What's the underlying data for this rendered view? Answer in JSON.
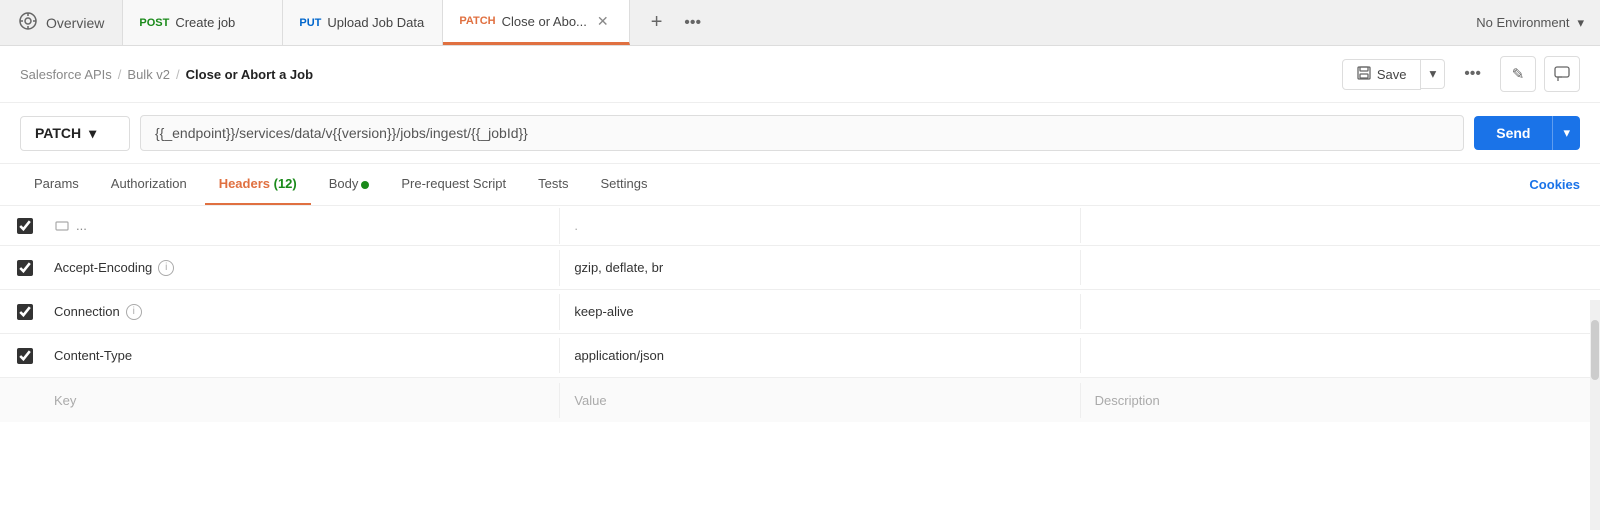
{
  "tabs": {
    "overview": {
      "label": "Overview",
      "icon": "○"
    },
    "items": [
      {
        "id": "create-job",
        "method": "POST",
        "method_class": "method-post",
        "label": "Create job",
        "active": false
      },
      {
        "id": "upload-job-data",
        "method": "PUT",
        "method_class": "method-put",
        "label": "Upload Job Data",
        "active": false
      },
      {
        "id": "close-abort-job",
        "method": "PATCH",
        "method_class": "method-patch",
        "label": "Close or Abo...",
        "active": true,
        "closable": true
      }
    ],
    "add_label": "+",
    "more_label": "•••"
  },
  "env": {
    "label": "No Environment",
    "chevron": "❯"
  },
  "breadcrumb": {
    "parts": [
      "Salesforce APIs",
      "Bulk v2"
    ],
    "current": "Close or Abort a Job"
  },
  "toolbar": {
    "save_label": "Save",
    "more_label": "•••",
    "edit_icon": "✎",
    "comment_icon": "▤"
  },
  "url_bar": {
    "method": "PATCH",
    "url_prefix": "{{_endpoint}}",
    "url_middle": "/services/data/v",
    "url_version": "{{version}}",
    "url_suffix1": "/jobs/ingest/",
    "url_suffix2": "{{_jobId}}",
    "send_label": "Send"
  },
  "request_tabs": {
    "items": [
      {
        "id": "params",
        "label": "Params",
        "active": false
      },
      {
        "id": "authorization",
        "label": "Authorization",
        "active": false
      },
      {
        "id": "headers",
        "label": "Headers",
        "badge": "12",
        "active": true
      },
      {
        "id": "body",
        "label": "Body",
        "dot": true,
        "active": false
      },
      {
        "id": "pre-request",
        "label": "Pre-request Script",
        "active": false
      },
      {
        "id": "tests",
        "label": "Tests",
        "active": false
      },
      {
        "id": "settings",
        "label": "Settings",
        "active": false
      }
    ],
    "cookies_label": "Cookies"
  },
  "headers": {
    "partial_key": "...",
    "partial_value": ".",
    "rows": [
      {
        "id": "accept-encoding",
        "checked": true,
        "key": "Accept-Encoding",
        "info": true,
        "value": "gzip, deflate, br",
        "description": ""
      },
      {
        "id": "connection",
        "checked": true,
        "key": "Connection",
        "info": true,
        "value": "keep-alive",
        "description": ""
      },
      {
        "id": "content-type",
        "checked": true,
        "key": "Content-Type",
        "info": false,
        "value": "application/json",
        "description": ""
      }
    ],
    "footer": {
      "key": "Key",
      "value": "Value",
      "description": "Description"
    }
  }
}
